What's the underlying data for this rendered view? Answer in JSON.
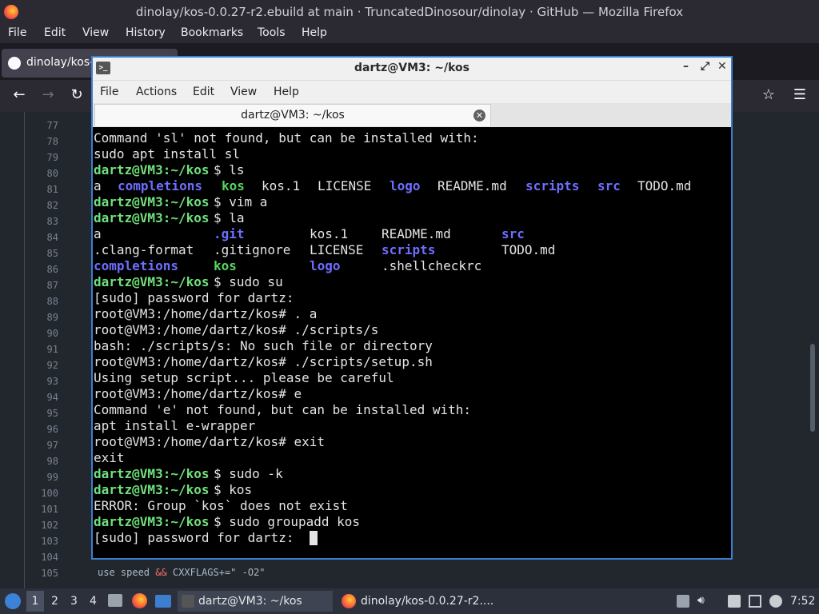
{
  "firefox": {
    "window_title": "dinolay/kos-0.0.27-r2.ebuild at main · TruncatedDinosour/dinolay · GitHub — Mozilla Firefox",
    "menu": [
      "File",
      "Edit",
      "View",
      "History",
      "Bookmarks",
      "Tools",
      "Help"
    ],
    "tab_label": "dinolay/kos-",
    "nav": {
      "back": "←",
      "forward": "→",
      "reload": "↻",
      "star": "☆",
      "menu": "☰"
    }
  },
  "editor": {
    "line_numbers": [
      "77",
      "78",
      "79",
      "80",
      "81",
      "82",
      "83",
      "84",
      "85",
      "86",
      "87",
      "88",
      "89",
      "90",
      "91",
      "92",
      "93",
      "94",
      "95",
      "96",
      "97",
      "98",
      "99",
      "100",
      "101",
      "102",
      "103",
      "104",
      "105"
    ],
    "code_105": {
      "pre": "use speed ",
      "op": "&&",
      "post": " CXXFLAGS+=\" -O2\""
    }
  },
  "terminal": {
    "window_title": "dartz@VM3: ~/kos",
    "icon_glyph": ">_",
    "window_buttons": {
      "minimize": "–",
      "maximize": "⤢",
      "close": "✕"
    },
    "menu": [
      "File",
      "Actions",
      "Edit",
      "View",
      "Help"
    ],
    "tab_label": "dartz@VM3: ~/kos",
    "tab_close": "✕",
    "lines": [
      {
        "segs": [
          {
            "t": "Command 'sl' not found, but can be installed with:",
            "c": "w"
          }
        ]
      },
      {
        "segs": [
          {
            "t": "sudo apt install sl",
            "c": "w"
          }
        ]
      },
      {
        "segs": [
          {
            "t": "dartz@VM3:~/kos",
            "c": "g"
          },
          {
            "t": "$ ls",
            "c": "w"
          }
        ]
      },
      {
        "segs": [
          {
            "t": "a",
            "c": "w",
            "col": 0
          },
          {
            "t": "completions",
            "c": "b",
            "col": 3
          },
          {
            "t": "kos",
            "c": "k",
            "col": 16
          },
          {
            "t": "kos.1",
            "c": "w",
            "col": 21
          },
          {
            "t": "LICENSE",
            "c": "w",
            "col": 28
          },
          {
            "t": "logo",
            "c": "b",
            "col": 37
          },
          {
            "t": "README.md",
            "c": "w",
            "col": 43
          },
          {
            "t": "scripts",
            "c": "b",
            "col": 54
          },
          {
            "t": "src",
            "c": "b",
            "col": 63
          },
          {
            "t": "TODO.md",
            "c": "w",
            "col": 68
          }
        ]
      },
      {
        "segs": [
          {
            "t": "dartz@VM3:~/kos",
            "c": "g"
          },
          {
            "t": "$ vim a",
            "c": "w"
          }
        ]
      },
      {
        "segs": [
          {
            "t": "dartz@VM3:~/kos",
            "c": "g"
          },
          {
            "t": "$ la",
            "c": "w"
          }
        ]
      },
      {
        "segs": [
          {
            "t": "a",
            "c": "w",
            "col": 0
          },
          {
            "t": ".git",
            "c": "b",
            "col": 15
          },
          {
            "t": "kos.1",
            "c": "w",
            "col": 27
          },
          {
            "t": "README.md",
            "c": "w",
            "col": 36
          },
          {
            "t": "src",
            "c": "b",
            "col": 51
          }
        ]
      },
      {
        "segs": [
          {
            "t": ".clang-format",
            "c": "w",
            "col": 0
          },
          {
            "t": ".gitignore",
            "c": "w",
            "col": 15
          },
          {
            "t": "LICENSE",
            "c": "w",
            "col": 27
          },
          {
            "t": "scripts",
            "c": "b",
            "col": 36
          },
          {
            "t": "TODO.md",
            "c": "w",
            "col": 51
          }
        ]
      },
      {
        "segs": [
          {
            "t": "completions",
            "c": "b",
            "col": 0
          },
          {
            "t": "kos",
            "c": "k",
            "col": 15
          },
          {
            "t": "logo",
            "c": "b",
            "col": 27
          },
          {
            "t": ".shellcheckrc",
            "c": "w",
            "col": 36
          }
        ]
      },
      {
        "segs": [
          {
            "t": "dartz@VM3:~/kos",
            "c": "g"
          },
          {
            "t": "$ sudo su",
            "c": "w"
          }
        ]
      },
      {
        "segs": [
          {
            "t": "[sudo] password for dartz:",
            "c": "w"
          }
        ]
      },
      {
        "segs": [
          {
            "t": "root@VM3:/home/dartz/kos# . a",
            "c": "w"
          }
        ]
      },
      {
        "segs": [
          {
            "t": "root@VM3:/home/dartz/kos# ./scripts/s",
            "c": "w"
          }
        ]
      },
      {
        "segs": [
          {
            "t": "bash: ./scripts/s: No such file or directory",
            "c": "w"
          }
        ]
      },
      {
        "segs": [
          {
            "t": "root@VM3:/home/dartz/kos# ./scripts/setup.sh",
            "c": "w"
          }
        ]
      },
      {
        "segs": [
          {
            "t": "Using setup script... please be careful",
            "c": "w"
          }
        ]
      },
      {
        "segs": [
          {
            "t": "root@VM3:/home/dartz/kos# e",
            "c": "w"
          }
        ]
      },
      {
        "segs": [
          {
            "t": "Command 'e' not found, but can be installed with:",
            "c": "w"
          }
        ]
      },
      {
        "segs": [
          {
            "t": "apt install e-wrapper",
            "c": "w"
          }
        ]
      },
      {
        "segs": [
          {
            "t": "root@VM3:/home/dartz/kos# exit",
            "c": "w"
          }
        ]
      },
      {
        "segs": [
          {
            "t": "exit",
            "c": "w"
          }
        ]
      },
      {
        "segs": [
          {
            "t": "dartz@VM3:~/kos",
            "c": "g"
          },
          {
            "t": "$ sudo -k",
            "c": "w"
          }
        ]
      },
      {
        "segs": [
          {
            "t": "dartz@VM3:~/kos",
            "c": "g"
          },
          {
            "t": "$ kos",
            "c": "w"
          }
        ]
      },
      {
        "segs": [
          {
            "t": "ERROR: Group `kos` does not exist",
            "c": "w"
          }
        ]
      },
      {
        "segs": [
          {
            "t": "dartz@VM3:~/kos",
            "c": "g"
          },
          {
            "t": "$ sudo groupadd kos",
            "c": "w"
          }
        ]
      },
      {
        "segs": [
          {
            "t": "[sudo] password for dartz: ",
            "c": "w"
          }
        ],
        "cursor": true
      }
    ]
  },
  "taskbar": {
    "workspaces": [
      "1",
      "2",
      "3",
      "4"
    ],
    "tasks": [
      {
        "label": "dartz@VM3: ~/kos"
      },
      {
        "label": "dinolay/kos-0.0.27-r2...."
      }
    ],
    "clock": "7:52",
    "tray_icons": [
      "update-icon",
      "volume-icon",
      "clipboard-icon",
      "network-icon",
      "notification-icon"
    ]
  }
}
